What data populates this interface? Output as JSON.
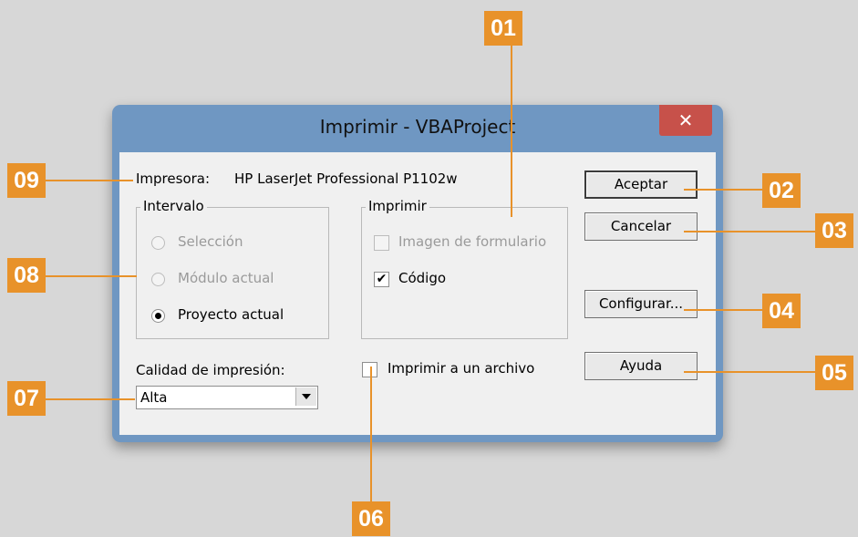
{
  "dialog": {
    "title": "Imprimir - VBAProject",
    "close_label": "✕",
    "printer_label": "Impresora:",
    "printer_name": "HP LaserJet Professional P1102w",
    "range_group": {
      "title": "Intervalo",
      "options": [
        {
          "label": "Selección",
          "enabled": false,
          "selected": false
        },
        {
          "label": "Módulo actual",
          "enabled": false,
          "selected": false
        },
        {
          "label": "Proyecto actual",
          "enabled": true,
          "selected": true
        }
      ]
    },
    "print_group": {
      "title": "Imprimir",
      "options": [
        {
          "label": "Imagen de formulario",
          "enabled": false,
          "checked": false
        },
        {
          "label": "Código",
          "enabled": true,
          "checked": true
        }
      ]
    },
    "quality_label": "Calidad de impresión:",
    "quality_value": "Alta",
    "print_to_file_label": "Imprimir a un archivo",
    "buttons": {
      "ok": "Aceptar",
      "cancel": "Cancelar",
      "setup": "Configurar...",
      "help": "Ayuda"
    }
  },
  "callouts": [
    "01",
    "02",
    "03",
    "04",
    "05",
    "06",
    "07",
    "08",
    "09"
  ],
  "colors": {
    "background": "#d7d7d7",
    "frame": "#6f97c2",
    "close": "#c7514a",
    "callout": "#e8922a"
  }
}
